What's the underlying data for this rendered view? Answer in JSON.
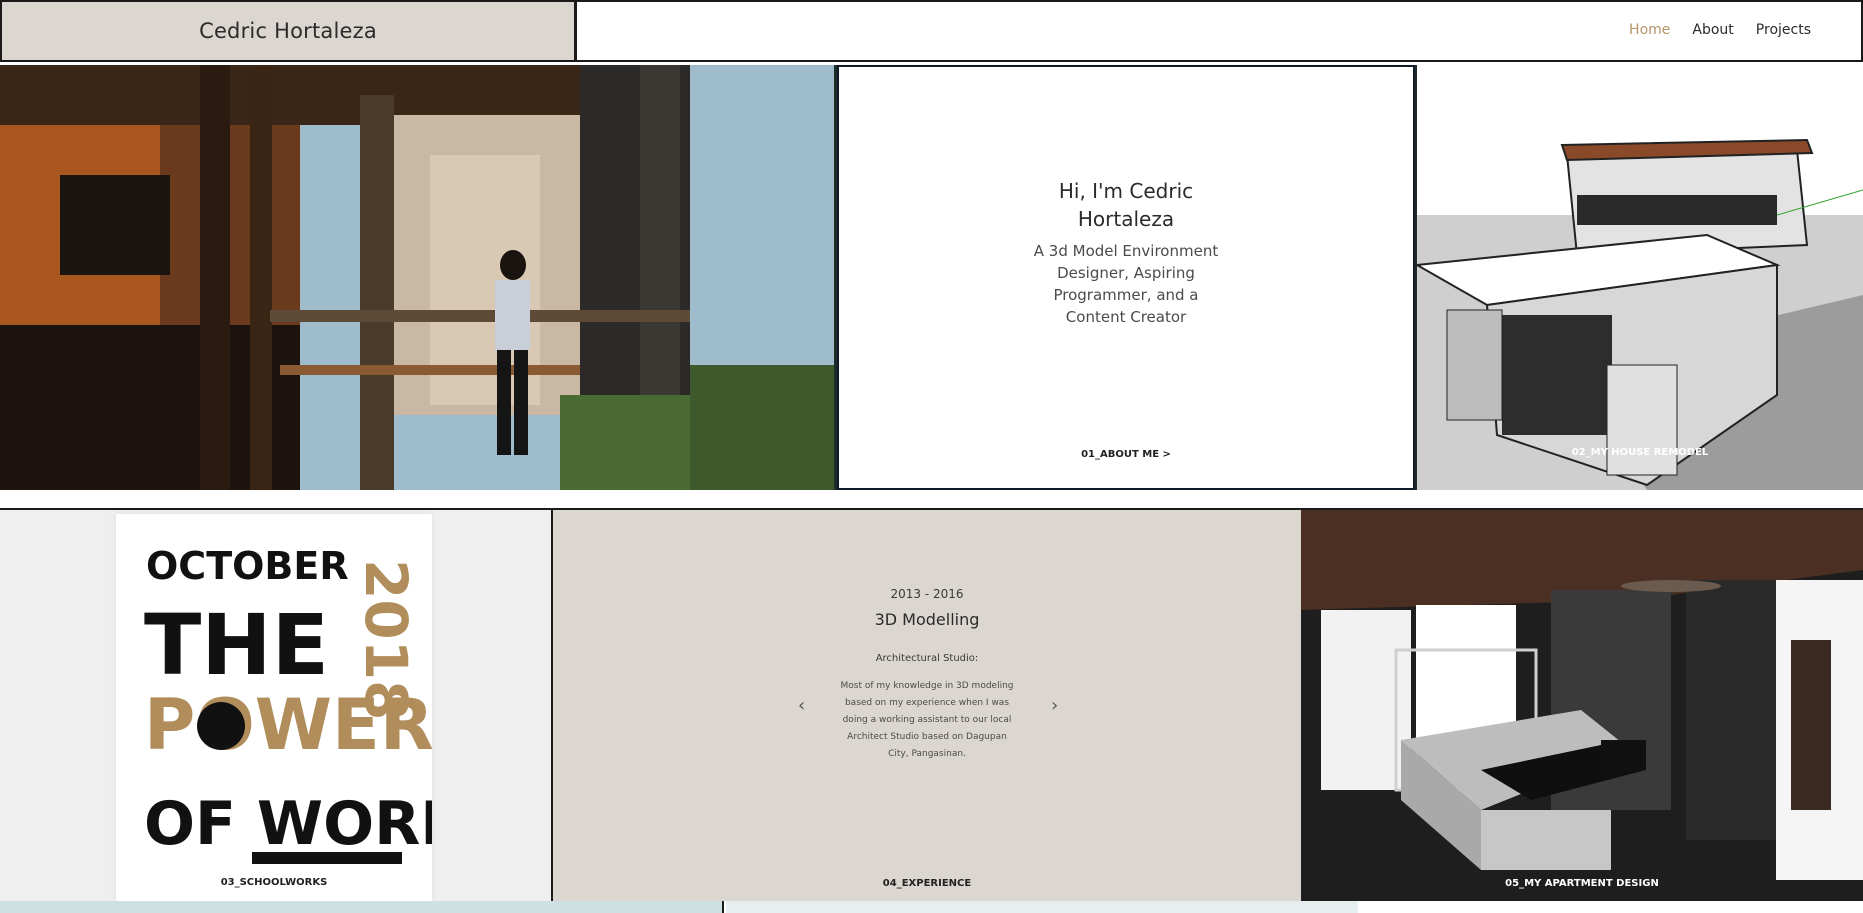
{
  "header": {
    "brand": "Cedric Hortaleza",
    "nav": [
      {
        "label": "Home",
        "active": true
      },
      {
        "label": "About",
        "active": false
      },
      {
        "label": "Projects",
        "active": false
      }
    ],
    "accent_color": "#b8966a"
  },
  "intro": {
    "name_line1": "Hi, I'm Cedric",
    "name_line2": "Hortaleza",
    "subtitle_lines": [
      "A 3d Model Environment",
      "Designer, Aspiring",
      "Programmer, and a",
      "Content Creator"
    ],
    "link": "01_ABOUT ME  >"
  },
  "tiles": {
    "house_remodel": "02_MY HOUSE REMODEL",
    "schoolworks": "03_SCHOOLWORKS",
    "experience_label": "04_EXPERIENCE",
    "apartment": "05_MY APARTMENT DESIGN"
  },
  "poster": {
    "words": [
      "OCTOBER",
      "THE",
      "POWER",
      "OF WORDS",
      "2018"
    ],
    "gold": "#b08d5a",
    "black": "#111111"
  },
  "experience": {
    "years": "2013 - 2016",
    "title": "3D Modelling",
    "studio": "Architectural Studio:",
    "description_lines": [
      "Most of my knowledge in 3D modeling",
      "based on my experience when I was",
      "doing a working assistant to our local",
      "Architect Studio based on Dagupan",
      "City, Pangasinan."
    ],
    "prev_icon": "‹",
    "next_icon": "›"
  }
}
